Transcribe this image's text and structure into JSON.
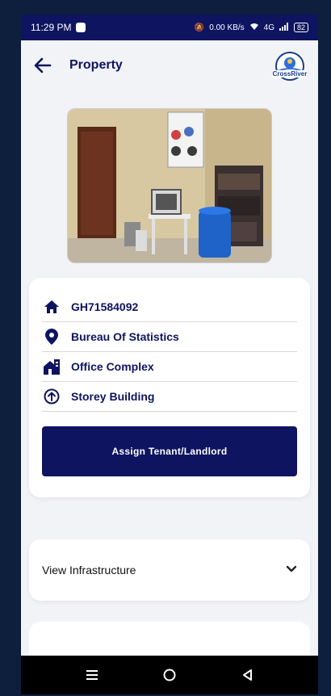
{
  "status_bar": {
    "time": "11:29 PM",
    "right_text": "0.00 KB/s",
    "network": "4G",
    "battery": "82"
  },
  "app_bar": {
    "title": "Property",
    "back_icon": "arrow-left-icon",
    "logo_text": "CrossRiver"
  },
  "property": {
    "id": "GH71584092",
    "location": "Bureau Of Statistics",
    "type": "Office Complex",
    "structure": "Storey Building"
  },
  "actions": {
    "assign_label": "Assign Tenant/Landlord"
  },
  "accordion": {
    "infrastructure_label": "View Infrastructure"
  },
  "colors": {
    "primary": "#0e1460",
    "background": "#f2f3f7",
    "status_bar": "#0e1460"
  }
}
